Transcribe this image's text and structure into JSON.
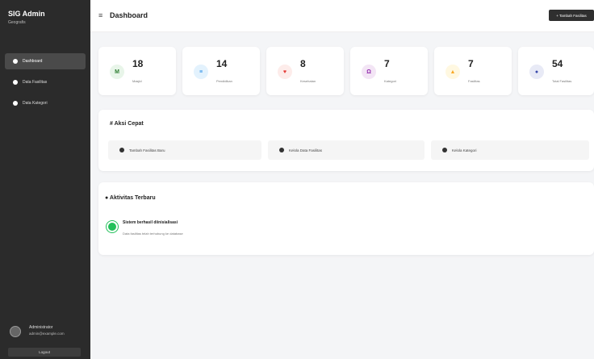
{
  "sidebar": {
    "brand": "SIG Admin",
    "brand_sub": "Geografis",
    "items": [
      {
        "label": "Dashboard"
      },
      {
        "label": "Data Fasilitas"
      },
      {
        "label": "Data Kategori"
      }
    ],
    "user": {
      "name": "Administrator",
      "email": "admin@example.com"
    },
    "logout_label": "Logout"
  },
  "topbar": {
    "menu_glyph": "≡",
    "title": "Dashboard",
    "add_button": "+ Tambah Fasilitas"
  },
  "stats": [
    {
      "value": "18",
      "label": "Masjid",
      "icon_glyph": "M",
      "color": "#2e7d32",
      "bg": "#e8f5e9"
    },
    {
      "value": "14",
      "label": "Pendidikan",
      "icon_glyph": "≡",
      "color": "#1e88e5",
      "bg": "#e3f2fd"
    },
    {
      "value": "8",
      "label": "Kesehatan",
      "icon_glyph": "♥",
      "color": "#e53935",
      "bg": "#fdecea"
    },
    {
      "value": "7",
      "label": "Kategori",
      "icon_glyph": "Ω",
      "color": "#8e24aa",
      "bg": "#f3e5f5"
    },
    {
      "value": "7",
      "label": "Fasilitas",
      "icon_glyph": "▲",
      "color": "#f9a825",
      "bg": "#fff8e1"
    },
    {
      "value": "54",
      "label": "Total Fasilitas",
      "icon_glyph": "●",
      "color": "#3949ab",
      "bg": "#e8eaf6"
    }
  ],
  "quick_actions": {
    "title": "# Aksi Cepat",
    "items": [
      {
        "label": "Tambah Fasilitas Baru"
      },
      {
        "label": "Kelola Data Fasilitas"
      },
      {
        "label": "Kelola Kategori"
      }
    ]
  },
  "activity": {
    "title": "Aktivitas Terbaru",
    "items": [
      {
        "title": "Sistem berhasil diinisialisasi",
        "desc": "Data fasilitas telah terhubung ke database"
      }
    ]
  }
}
